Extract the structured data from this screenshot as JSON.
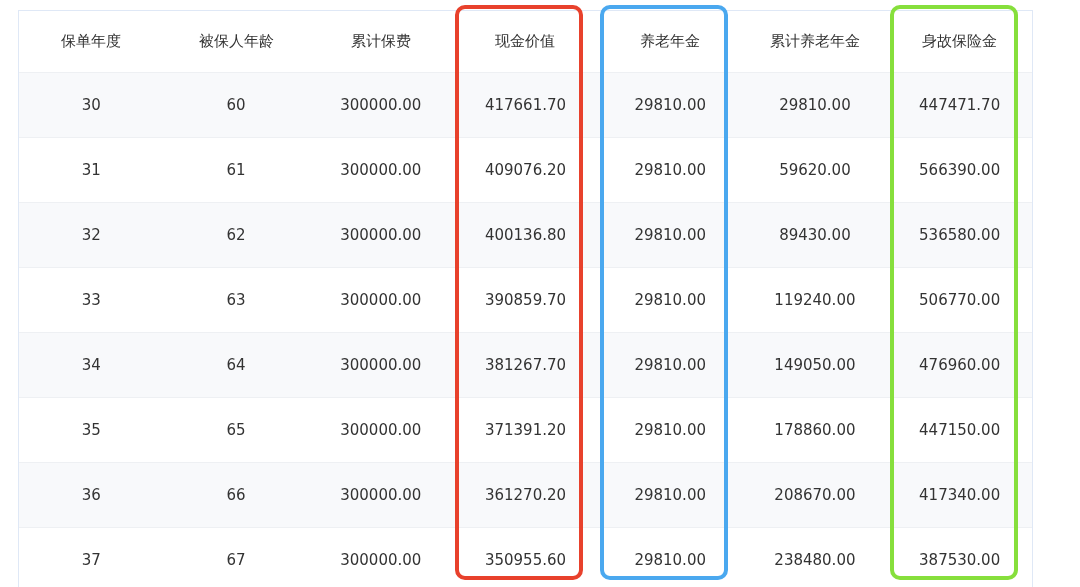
{
  "table": {
    "columns": [
      {
        "label": "保单年度"
      },
      {
        "label": "被保人年龄"
      },
      {
        "label": "累计保费"
      },
      {
        "label": "现金价值",
        "color": "#e8412c"
      },
      {
        "label": "养老年金",
        "color": "#4aa8ef"
      },
      {
        "label": "累计养老年金"
      },
      {
        "label": "身故保险金",
        "color": "#86df3c"
      }
    ],
    "rows": [
      [
        "30",
        "60",
        "300000.00",
        "417661.70",
        "29810.00",
        "29810.00",
        "447471.70"
      ],
      [
        "31",
        "61",
        "300000.00",
        "409076.20",
        "29810.00",
        "59620.00",
        "566390.00"
      ],
      [
        "32",
        "62",
        "300000.00",
        "400136.80",
        "29810.00",
        "89430.00",
        "536580.00"
      ],
      [
        "33",
        "63",
        "300000.00",
        "390859.70",
        "29810.00",
        "119240.00",
        "506770.00"
      ],
      [
        "34",
        "64",
        "300000.00",
        "381267.70",
        "29810.00",
        "149050.00",
        "476960.00"
      ],
      [
        "35",
        "65",
        "300000.00",
        "371391.20",
        "29810.00",
        "178860.00",
        "447150.00"
      ],
      [
        "36",
        "66",
        "300000.00",
        "361270.20",
        "29810.00",
        "208670.00",
        "417340.00"
      ],
      [
        "37",
        "67",
        "300000.00",
        "350955.60",
        "29810.00",
        "238480.00",
        "387530.00"
      ]
    ]
  }
}
